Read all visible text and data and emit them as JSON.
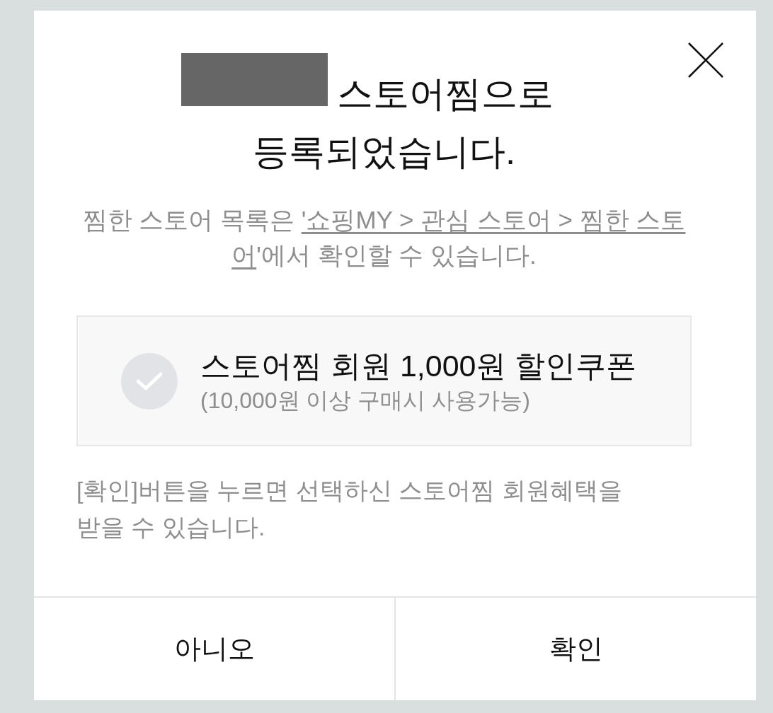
{
  "dialog": {
    "title": {
      "store_name_redacted": true,
      "lines": [
        "스토어찜으로",
        "등록되었습니다."
      ]
    },
    "description": {
      "before": "찜한 스토어 목록은",
      "link_lines": [
        "'쇼핑MY > 관심 스토어 > 찜한 스토",
        "어"
      ],
      "after": "'에서 확인할 수 있습니다."
    },
    "coupon": {
      "checked": false,
      "title": "스토어찜 회원 1,000원 할인쿠폰",
      "condition": "(10,000원 이상 구매시 사용가능)"
    },
    "notice": "[확인]버튼을 누르면 선택하신 스토어찜 회원혜택을 받을 수 있습니다.",
    "buttons": [
      "아니오",
      "확인"
    ]
  }
}
